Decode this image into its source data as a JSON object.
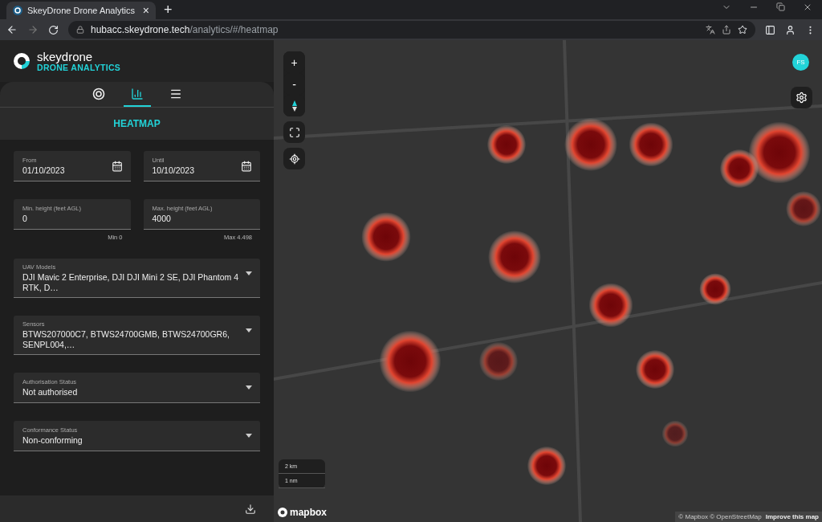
{
  "browser": {
    "tab_title": "SkeyDrone Drone Analytics",
    "tab_close": "×",
    "new_tab": "+",
    "url_host": "hubacc.skeydrone.tech",
    "url_path": "/analytics/#/heatmap"
  },
  "app": {
    "brand": "skeydrone",
    "subtitle": "DRONE ANALYTICS"
  },
  "tabs": [
    {
      "selected": false
    },
    {
      "selected": true
    },
    {
      "selected": false
    }
  ],
  "panel_title": "HEATMAP",
  "dates": [
    {
      "label": "From",
      "value": "01/10/2023"
    },
    {
      "label": "Until",
      "value": "10/10/2023"
    }
  ],
  "heights": [
    {
      "label": "Min. height (feet AGL)",
      "value": "0",
      "hint": "Min 0"
    },
    {
      "label": "Max. height (feet AGL)",
      "value": "4000",
      "hint": "Max 4.498"
    }
  ],
  "selects": [
    {
      "label": "UAV Models",
      "value": "DJI Mavic 2 Enterprise, DJI DJI Mini 2 SE, DJI Phantom 4 RTK, D…"
    },
    {
      "label": "Sensors",
      "value": "BTWS207000C7, BTWS24700GMB, BTWS24700GR6, SENPL004,…"
    },
    {
      "label": "Authorisation Status",
      "value": "Not authorised"
    },
    {
      "label": "Conformance Status",
      "value": "Non-conforming"
    }
  ],
  "map": {
    "zoom_in": "+",
    "zoom_out": "-",
    "avatar": "FS",
    "scale": [
      "2 km",
      "1 nm"
    ],
    "logo": "mapbox",
    "attribution": "© Mapbox © OpenStreetMap",
    "improve_link": "Improve this map"
  }
}
